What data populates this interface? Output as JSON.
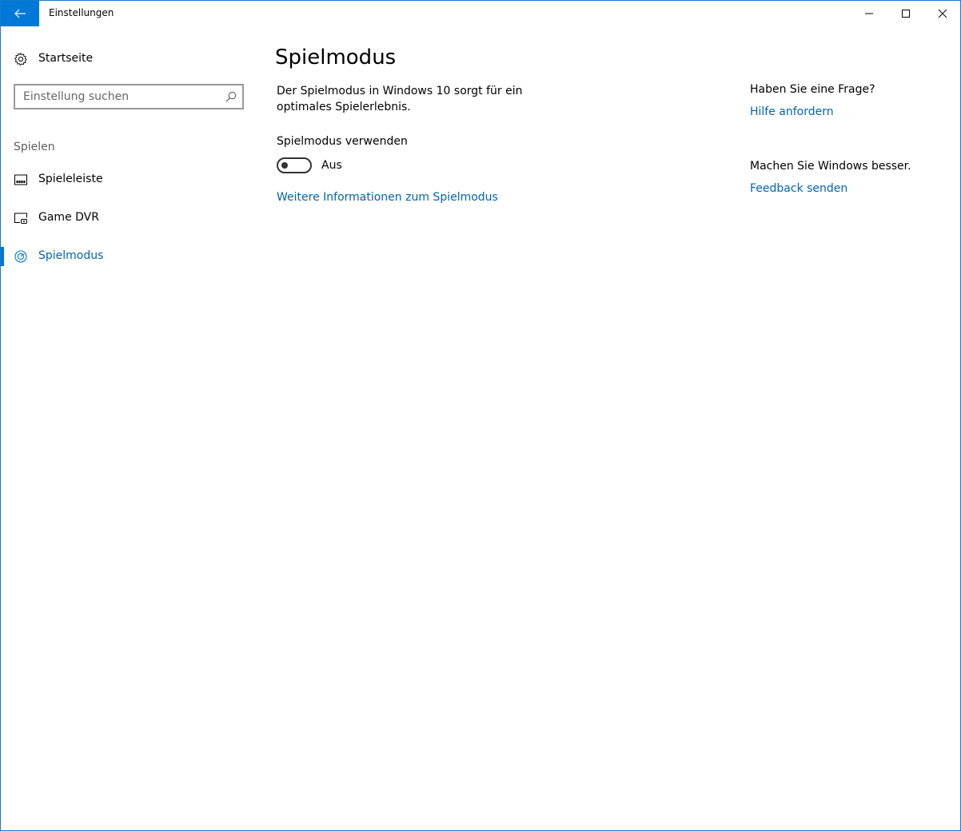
{
  "window": {
    "title": "Einstellungen"
  },
  "sidebar": {
    "home_label": "Startseite",
    "search": {
      "placeholder": "Einstellung suchen",
      "value": ""
    },
    "section_label": "Spielen",
    "items": [
      {
        "label": "Spieleleiste",
        "icon": "game-bar-icon"
      },
      {
        "label": "Game DVR",
        "icon": "game-dvr-icon"
      },
      {
        "label": "Spielmodus",
        "icon": "game-mode-icon",
        "selected": true
      }
    ]
  },
  "main": {
    "title": "Spielmodus",
    "description": "Der Spielmodus in Windows 10 sorgt für ein optimales Spielerlebnis.",
    "toggle": {
      "label": "Spielmodus verwenden",
      "state": "Aus",
      "on": false
    },
    "more_info_link": "Weitere Informationen zum Spielmodus"
  },
  "help": {
    "question_heading": "Haben Sie eine Frage?",
    "help_link": "Hilfe anfordern",
    "feedback_heading": "Machen Sie Windows besser.",
    "feedback_link": "Feedback senden"
  },
  "colors": {
    "accent": "#0078d7",
    "link": "#0063b1",
    "section_label": "#5d5d5d"
  }
}
